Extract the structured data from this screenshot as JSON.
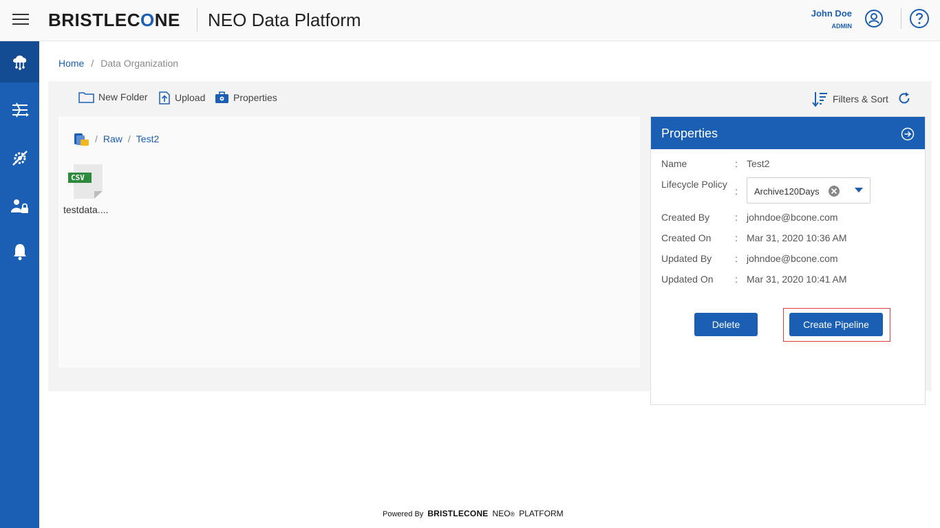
{
  "header": {
    "logo_text_a": "BRISTLEC",
    "logo_text_o": "O",
    "logo_text_b": "NE",
    "app_title": "NEO Data Platform",
    "user_name": "John Doe",
    "user_role": "ADMIN"
  },
  "sidebar": {
    "items": [
      {
        "icon": "cloud-network-icon"
      },
      {
        "icon": "pipeline-icon"
      },
      {
        "icon": "settings-tools-icon"
      },
      {
        "icon": "user-lock-icon"
      },
      {
        "icon": "bell-icon"
      }
    ]
  },
  "breadcrumb": {
    "home": "Home",
    "sep": "/",
    "current": "Data Organization"
  },
  "toolbar": {
    "new_folder": "New Folder",
    "upload": "Upload",
    "properties": "Properties",
    "filters_sort": "Filters & Sort"
  },
  "path": {
    "sep": "/",
    "items": [
      "Raw",
      "Test2"
    ]
  },
  "files": [
    {
      "badge": "CSV",
      "name": "testdata...."
    }
  ],
  "properties": {
    "title": "Properties",
    "name_label": "Name",
    "name_value": "Test2",
    "lifecycle_label": "Lifecycle Policy",
    "lifecycle_value": "Archive120Days",
    "created_by_label": "Created By",
    "created_by_value": "johndoe@bcone.com",
    "created_on_label": "Created On",
    "created_on_value": "Mar 31, 2020 10:36 AM",
    "updated_by_label": "Updated By",
    "updated_by_value": "johndoe@bcone.com",
    "updated_on_label": "Updated On",
    "updated_on_value": "Mar 31, 2020 10:41 AM",
    "colon": ":",
    "delete_label": "Delete",
    "create_pipeline_label": "Create Pipeline"
  },
  "footer": {
    "powered_by": "Powered By",
    "brand": "BRISTLECONE",
    "neo": "NEO",
    "reg": "®",
    "platform": "PLATFORM"
  },
  "colors": {
    "primary": "#1a5fb4",
    "highlight": "#e03a3a",
    "csv_badge": "#2e8b3d"
  }
}
